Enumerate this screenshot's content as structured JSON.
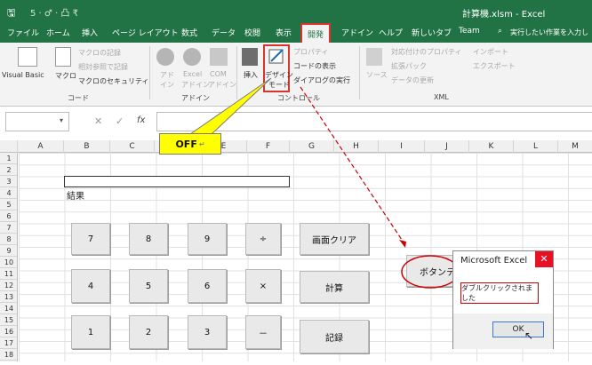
{
  "titlebar": {
    "quick_access": "5 · ♂ · 凸 ₹",
    "file_title": "計算機.xlsm - Excel"
  },
  "tabs": [
    "ファイル",
    "ホーム",
    "挿入",
    "ページ レイアウト",
    "数式",
    "データ",
    "校閲",
    "表示",
    "開発",
    "アドイン",
    "ヘルプ",
    "新しいタブ",
    "Team"
  ],
  "tell_me": "実行したい作業を入力し",
  "ribbon": {
    "code": {
      "vb": "Visual Basic",
      "macro": "マクロ",
      "record": "マクロの記録",
      "relative": "相対参照で記録",
      "security": "マクロのセキュリティ",
      "group": "コード"
    },
    "addins": {
      "a1": "アド",
      "a1b": "イン",
      "a2": "Excel",
      "a2b": "アドイン",
      "a3": "COM",
      "a3b": "アドイン",
      "group": "アドイン"
    },
    "controls": {
      "insert": "挿入",
      "design": "デザイン",
      "design_b": "モード",
      "props": "プロパティ",
      "view_code": "コードの表示",
      "dialog": "ダイアログの実行",
      "group": "コントロール"
    },
    "xml": {
      "source": "ソース",
      "map": "対応付けのプロパティ",
      "pack": "拡張パック",
      "refresh": "データの更新",
      "import": "インポート",
      "export": "エクスポート",
      "group": "XML"
    }
  },
  "formula": {
    "cancel": "✕",
    "enter": "✓",
    "fx": "fx"
  },
  "columns": [
    "A",
    "B",
    "C",
    "D",
    "E",
    "F",
    "G",
    "H",
    "I",
    "J",
    "K",
    "L",
    "M"
  ],
  "rows": [
    "1",
    "2",
    "3",
    "4",
    "5",
    "6",
    "7",
    "8",
    "9",
    "10",
    "11",
    "12",
    "13",
    "14",
    "15",
    "16",
    "17",
    "18"
  ],
  "cells": {
    "result_label": "結果"
  },
  "callout": "OFF",
  "buttons": {
    "b7": "7",
    "b8": "8",
    "b9": "9",
    "div": "÷",
    "clear": "画面クリア",
    "b4": "4",
    "b5": "5",
    "b6": "6",
    "mul": "×",
    "calc": "計算",
    "b1": "1",
    "b2": "2",
    "b3": "3",
    "sub": "－",
    "rec": "記録",
    "test": "ボタンテ"
  },
  "dialog": {
    "title": "Microsoft Excel",
    "close": "✕",
    "message": "ダブルクリックされました",
    "ok": "OK"
  },
  "colors": {
    "excel_green": "#217346",
    "highlight": "#d9342b",
    "callout": "#ffff00"
  }
}
